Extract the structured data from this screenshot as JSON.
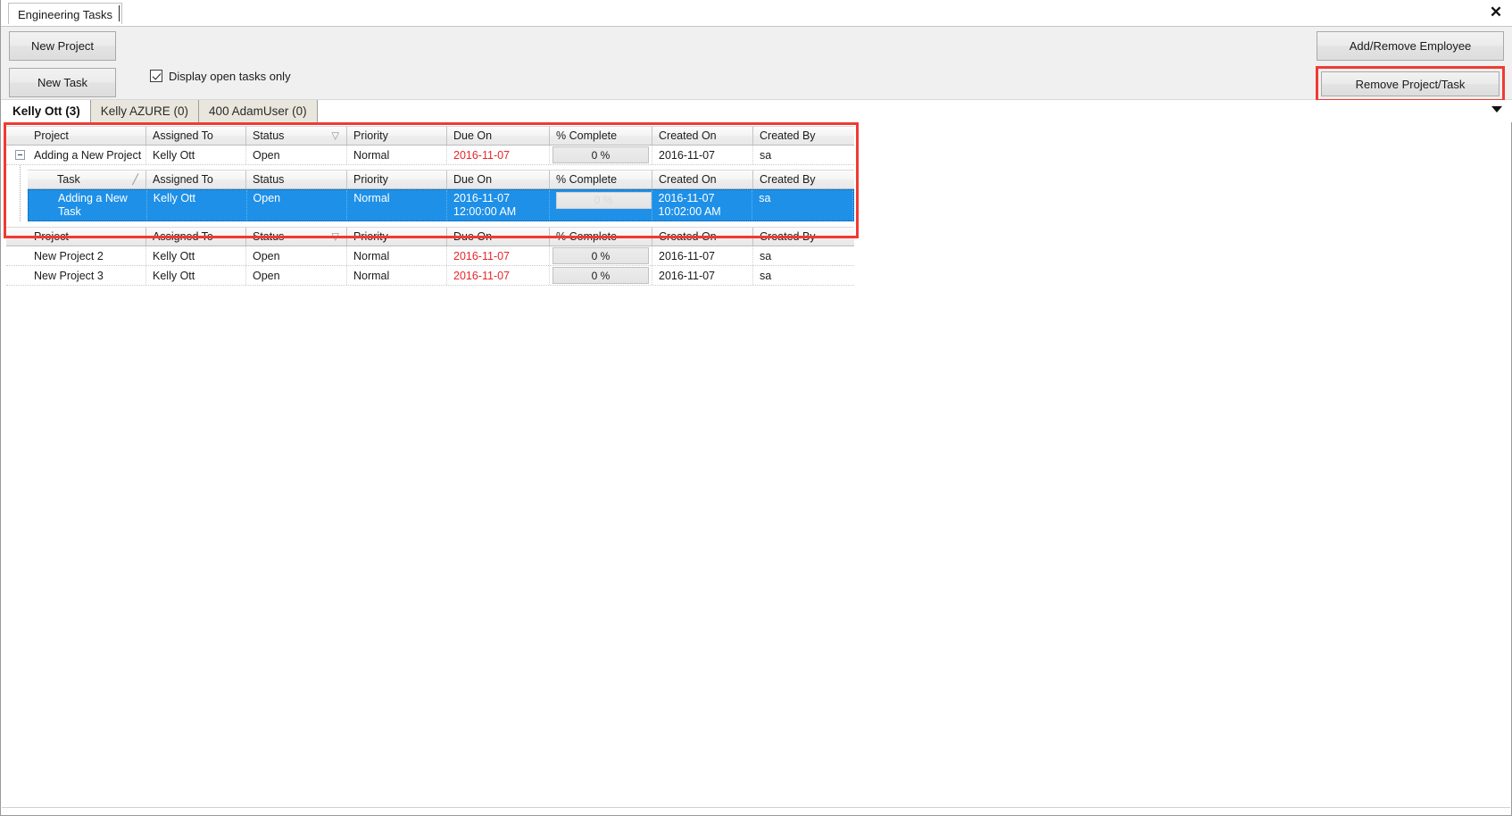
{
  "window": {
    "doc_tab_label": "Engineering Tasks",
    "close_icon": "close-icon",
    "close_glyph": "✕"
  },
  "toolbar": {
    "new_project_label": "New Project",
    "new_task_label": "New Task",
    "display_open_tasks_label": "Display open tasks only",
    "display_open_tasks_checked": true,
    "add_remove_employee_label": "Add/Remove Employee",
    "remove_project_task_label": "Remove Project/Task",
    "highlight_color": "#ef3b33"
  },
  "employee_tabs": {
    "items": [
      {
        "label": "Kelly Ott (3)",
        "active": true
      },
      {
        "label": "Kelly AZURE (0)",
        "active": false
      },
      {
        "label": "400 AdamUser (0)",
        "active": false
      }
    ],
    "overflow_icon": "chevron-down-icon"
  },
  "grid": {
    "project_headers": [
      "Project",
      "Assigned To",
      "Status",
      "Priority",
      "Due On",
      "% Complete",
      "Created On",
      "Created By"
    ],
    "task_headers": [
      "Task",
      "Assigned To",
      "Status",
      "Priority",
      "Due On",
      "% Complete",
      "Created On",
      "Created By"
    ],
    "status_sort_glyph": "▽",
    "task_sort_glyph": "╱",
    "selection_color": "#1e90e8",
    "overdue_color": "#e8252b",
    "expanded_project": {
      "project": "Adding a New Project",
      "assigned_to": "Kelly Ott",
      "status": "Open",
      "priority": "Normal",
      "due_on": "2016-11-07",
      "percent_complete": "0 %",
      "created_on": "2016-11-07",
      "created_by": "sa",
      "expander_icon": "collapse-minus-icon",
      "expanded": true
    },
    "tasks": [
      {
        "task": "Adding a New Task",
        "assigned_to": "Kelly Ott",
        "status": "Open",
        "priority": "Normal",
        "due_on": "2016-11-07 12:00:00 AM",
        "percent_complete": "0 %",
        "created_on": "2016-11-07 10:02:00 AM",
        "created_by": "sa",
        "selected": true
      }
    ],
    "projects": [
      {
        "project": "New Project 2",
        "assigned_to": "Kelly Ott",
        "status": "Open",
        "priority": "Normal",
        "due_on": "2016-11-07",
        "percent_complete": "0 %",
        "created_on": "2016-11-07",
        "created_by": "sa"
      },
      {
        "project": "New Project 3",
        "assigned_to": "Kelly Ott",
        "status": "Open",
        "priority": "Normal",
        "due_on": "2016-11-07",
        "percent_complete": "0 %",
        "created_on": "2016-11-07",
        "created_by": "sa"
      }
    ]
  }
}
